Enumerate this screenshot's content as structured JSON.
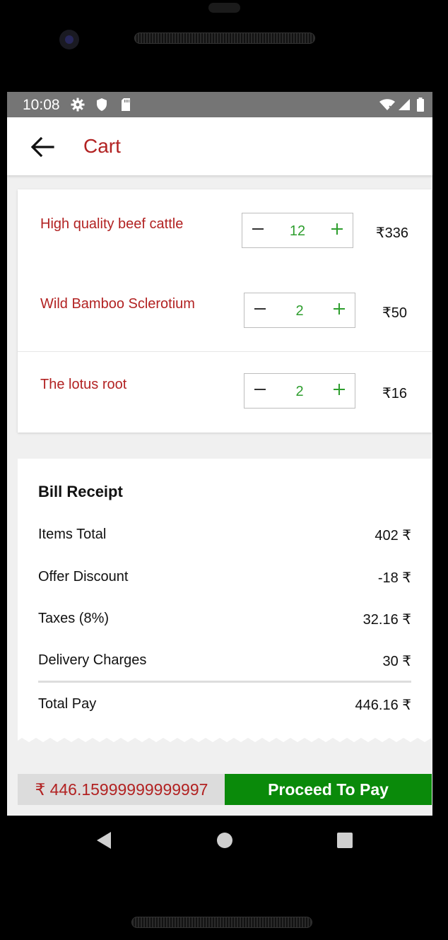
{
  "status_bar": {
    "time": "10:08",
    "icons": [
      "gear-icon",
      "shield-icon",
      "sd-card-icon",
      "wifi-icon",
      "signal-icon",
      "battery-icon"
    ]
  },
  "app_bar": {
    "back_icon": "arrow-left-icon",
    "title": "Cart"
  },
  "cart": {
    "items": [
      {
        "name": "High quality beef cattle",
        "quantity": "12",
        "price": "₹336"
      },
      {
        "name": "Wild Bamboo Sclerotium",
        "quantity": "2",
        "price": "₹50"
      },
      {
        "name": "The lotus root",
        "quantity": "2",
        "price": "₹16"
      }
    ],
    "decrement_icon": "minus-icon",
    "increment_icon": "plus-icon"
  },
  "bill": {
    "title": "Bill Receipt",
    "rows": [
      {
        "label": "Items Total",
        "value": "402 ₹"
      },
      {
        "label": "Offer Discount",
        "value": "-18 ₹"
      },
      {
        "label": "Taxes (8%)",
        "value": "32.16 ₹"
      },
      {
        "label": "Delivery Charges",
        "value": "30 ₹"
      }
    ],
    "total": {
      "label": "Total Pay",
      "value": "446.16 ₹"
    }
  },
  "footer": {
    "total_display": "₹ 446.15999999999997",
    "pay_label": "Proceed To Pay"
  },
  "colors": {
    "accent_red": "#b22222",
    "quantity_green": "#2e9e2e",
    "pay_green": "#0a8a0a",
    "status_bar_gray": "#757575"
  },
  "nav_bar": {
    "icons": [
      "back-triangle-icon",
      "home-circle-icon",
      "recents-square-icon"
    ]
  }
}
